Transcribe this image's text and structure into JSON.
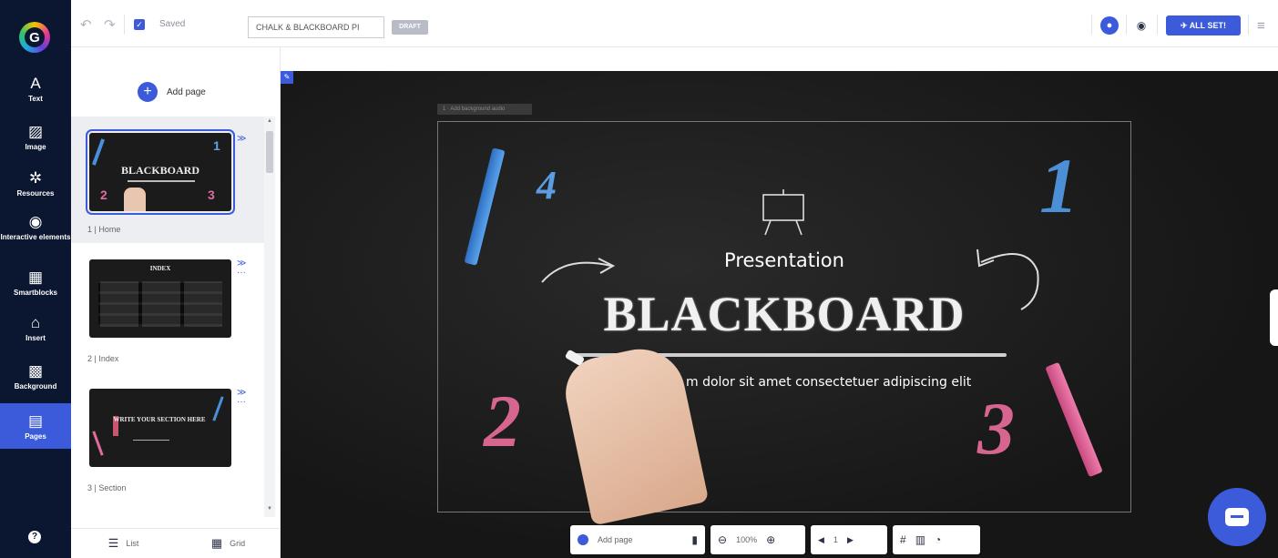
{
  "app": {
    "logo": "G"
  },
  "rail": {
    "items": [
      {
        "icon": "A",
        "label": "Text"
      },
      {
        "icon": "▨",
        "label": "Image"
      },
      {
        "icon": "✲",
        "label": "Resources"
      },
      {
        "icon": "◉",
        "label": "Interactive elements"
      },
      {
        "icon": "▦",
        "label": "Smartblocks"
      },
      {
        "icon": "⌂",
        "label": "Insert"
      },
      {
        "icon": "▩",
        "label": "Background"
      },
      {
        "icon": "▤",
        "label": "Pages"
      }
    ],
    "help_icon": "?"
  },
  "topbar": {
    "saved_label": "Saved",
    "title_value": "CHALK & BLACKBOARD PI",
    "draft_badge": "DRAFT",
    "allset_label": "ALL SET!"
  },
  "panel": {
    "add_page_label": "Add page",
    "pages": [
      {
        "label": "1 | Home",
        "thumb_text": "BLACKBOARD"
      },
      {
        "label": "2 | Index",
        "thumb_text": "INDEX"
      },
      {
        "label": "3 | Section",
        "thumb_text": "WRITE YOUR SECTION HERE"
      }
    ],
    "views": [
      {
        "icon": "list-icon",
        "label": "List"
      },
      {
        "icon": "grid-icon",
        "label": "Grid"
      }
    ]
  },
  "slide": {
    "tag": "1 · Add background audio",
    "subtitle": "Presentation",
    "title": "BLACKBOARD",
    "body": "m dolor sit amet consectetuer adipiscing elit",
    "numbers": [
      "4",
      "1",
      "2",
      "3"
    ]
  },
  "bottom_toolbar": {
    "add_page_label": "Add page",
    "zoom": "100%",
    "page_number": "1"
  }
}
